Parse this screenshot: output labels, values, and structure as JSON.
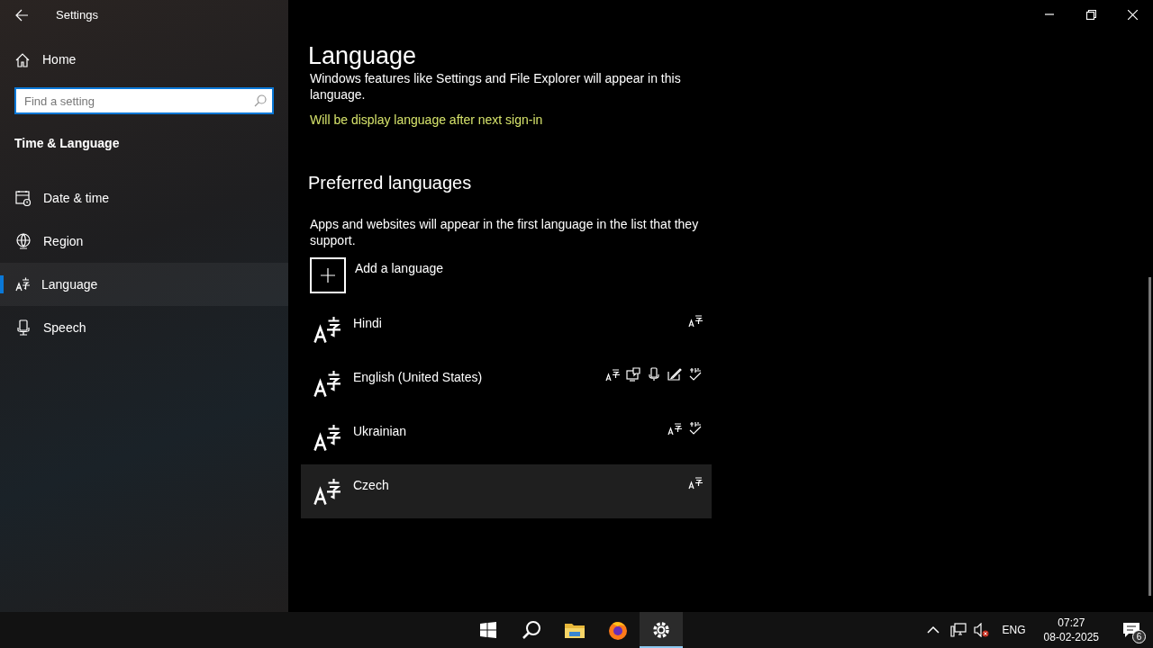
{
  "window": {
    "title": "Settings"
  },
  "sidebar": {
    "home": "Home",
    "search": {
      "placeholder": "Find a setting"
    },
    "section": "Time & Language",
    "items": [
      {
        "label": "Date & time",
        "kind": "calendar",
        "selected": false
      },
      {
        "label": "Region",
        "kind": "globe",
        "selected": false
      },
      {
        "label": "Language",
        "kind": "language",
        "selected": true
      },
      {
        "label": "Speech",
        "kind": "mic",
        "selected": false
      }
    ]
  },
  "page": {
    "title": "Language",
    "cut_text": "Windows features like Settings and File Explorer will appear in this",
    "text_end": "language.",
    "notice": "Will be display language after next sign-in",
    "preferred": {
      "heading": "Preferred languages",
      "description": "Apps and websites will appear in the first language in the list that they support.",
      "add": "Add a language",
      "languages": [
        {
          "name": "Hindi",
          "selected": false,
          "features": [
            {
              "kind": "display"
            }
          ]
        },
        {
          "name": "English (United States)",
          "selected": false,
          "features": [
            {
              "kind": "display"
            },
            {
              "kind": "tts"
            },
            {
              "kind": "speech"
            },
            {
              "kind": "handwriting"
            },
            {
              "kind": "spelling"
            }
          ]
        },
        {
          "name": "Ukrainian",
          "selected": false,
          "features": [
            {
              "kind": "display"
            },
            {
              "kind": "spelling"
            }
          ]
        },
        {
          "name": "Czech",
          "selected": true,
          "features": [
            {
              "kind": "display"
            }
          ]
        }
      ]
    }
  },
  "taskbar": {
    "apps": [
      {
        "kind": "start",
        "active": false
      },
      {
        "kind": "search",
        "active": false
      },
      {
        "kind": "folder",
        "active": false
      },
      {
        "kind": "browser",
        "active": false
      },
      {
        "kind": "settings",
        "active": true
      }
    ],
    "language": "ENG",
    "time": "07:27",
    "date": "08-02-2025",
    "notifications": "6"
  }
}
